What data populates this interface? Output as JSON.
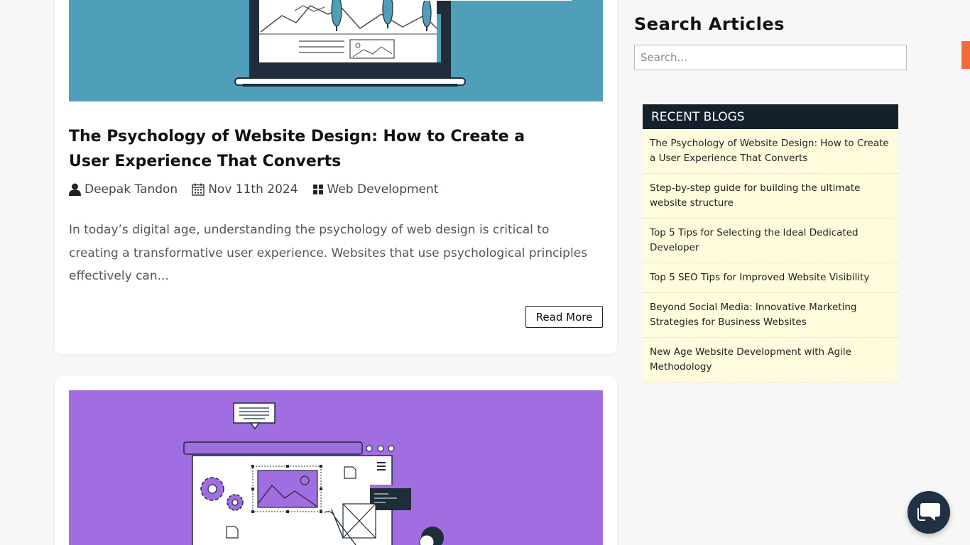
{
  "post": {
    "title": "The Psychology of Website Design: How to Create a User Experience That Converts",
    "author": "Deepak Tandon",
    "date": "Nov 11th 2024",
    "category": "Web Development",
    "excerpt": "In today’s digital age, understanding the psychology of web design is critical to creating a transformative user experience. Websites that use psychological principles effectively can...",
    "read_more_label": "Read More"
  },
  "sidebar": {
    "search_title": "Search Articles",
    "search_placeholder": "Search...",
    "recent_heading": "RECENT BLOGS",
    "recent_items": [
      "The Psychology of Website Design: How to Create a User Experience That Converts",
      "Step-by-step guide for building the ultimate website structure",
      "Top 5 Tips for Selecting the Ideal Dedicated Developer",
      "Top 5 SEO Tips for Improved Website Visibility",
      "Beyond Social Media: Innovative Marketing Strategies for Business Websites",
      "New Age Website Development with Agile Methodology"
    ]
  },
  "colors": {
    "hero1_bg": "#4f9fba",
    "hero2_bg": "#a06ee0",
    "recent_head_bg": "#14202c",
    "recent_list_bg": "#fffbdc",
    "accent": "#f26a3d",
    "chat_bg": "#1f3142"
  },
  "icons": {
    "author": "user-icon",
    "date": "calendar-icon",
    "category": "grid-icon",
    "chat": "chat-bubble-icon"
  }
}
